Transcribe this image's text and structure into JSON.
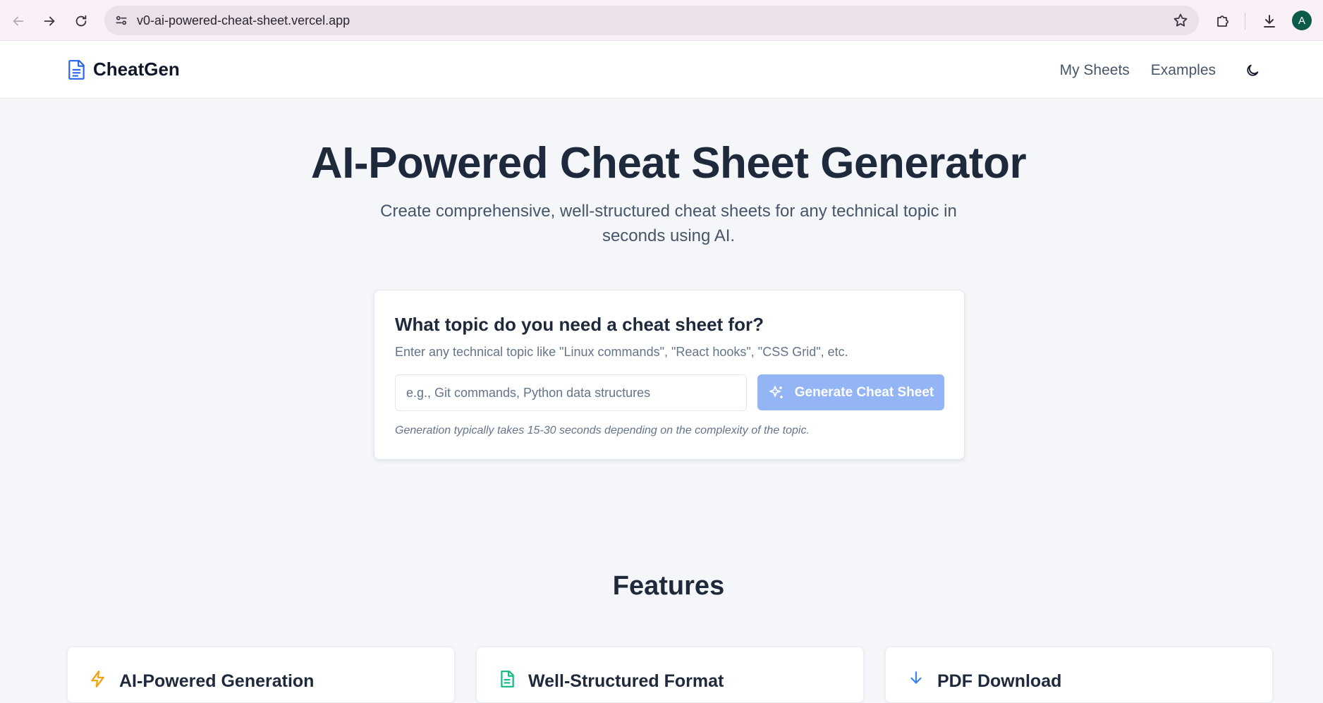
{
  "browser": {
    "url": "v0-ai-powered-cheat-sheet.vercel.app",
    "avatar_initial": "A"
  },
  "header": {
    "brand": "CheatGen",
    "nav": [
      "My Sheets",
      "Examples"
    ]
  },
  "hero": {
    "title": "AI-Powered Cheat Sheet Generator",
    "subtitle": "Create comprehensive, well-structured cheat sheets for any technical topic in seconds using AI."
  },
  "topic_card": {
    "title": "What topic do you need a cheat sheet for?",
    "description": "Enter any technical topic like \"Linux commands\", \"React hooks\", \"CSS Grid\", etc.",
    "input_placeholder": "e.g., Git commands, Python data structures",
    "input_value": "",
    "button_label": "Generate Cheat Sheet",
    "note": "Generation typically takes 15-30 seconds depending on the complexity of the topic."
  },
  "features": {
    "title": "Features",
    "items": [
      {
        "title": "AI-Powered Generation",
        "icon": "lightning-icon",
        "color": "#f59e0b"
      },
      {
        "title": "Well-Structured Format",
        "icon": "document-icon",
        "color": "#10b981"
      },
      {
        "title": "PDF Download",
        "icon": "download-icon",
        "color": "#3b82f6"
      }
    ]
  },
  "colors": {
    "accent": "#2563eb",
    "button_disabled": "#93b5f5"
  }
}
